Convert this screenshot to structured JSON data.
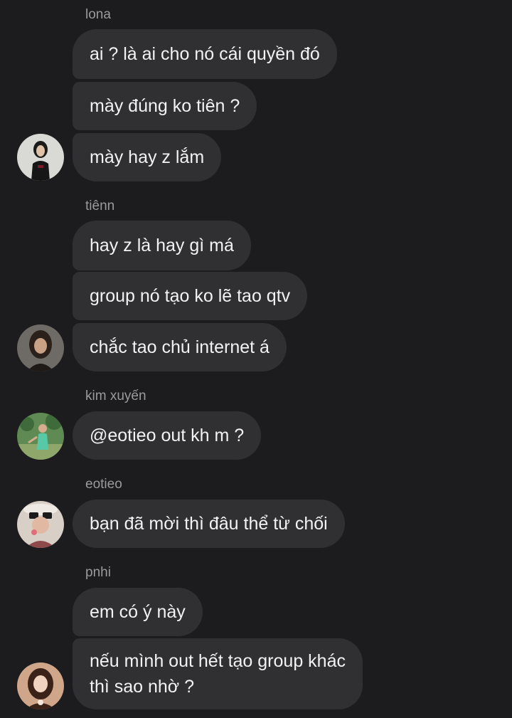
{
  "chat": {
    "messages": [
      {
        "sender": "lona",
        "lines": [
          "ai ? là ai cho nó cái quyền đó",
          "mày đúng ko tiên ?",
          "mày hay z lắm"
        ]
      },
      {
        "sender": "tiênn",
        "lines": [
          "hay z là hay gì má",
          "group nó tạo ko lẽ tao qtv",
          "chắc tao chủ internet á"
        ]
      },
      {
        "sender": "kim xuyến",
        "lines": [
          "@eotieo out kh m ?"
        ]
      },
      {
        "sender": "eotieo",
        "lines": [
          "bạn đã mời thì đâu thể từ chối"
        ]
      },
      {
        "sender": "pnhi",
        "lines": [
          "em có ý này",
          "nếu mình out hết tạo group khác\nthì sao nhờ ?"
        ]
      }
    ]
  },
  "colors": {
    "background": "#1c1c1e",
    "bubble": "#303032",
    "message_text": "#f2f2f4",
    "sender_text": "#9a9a9f"
  }
}
